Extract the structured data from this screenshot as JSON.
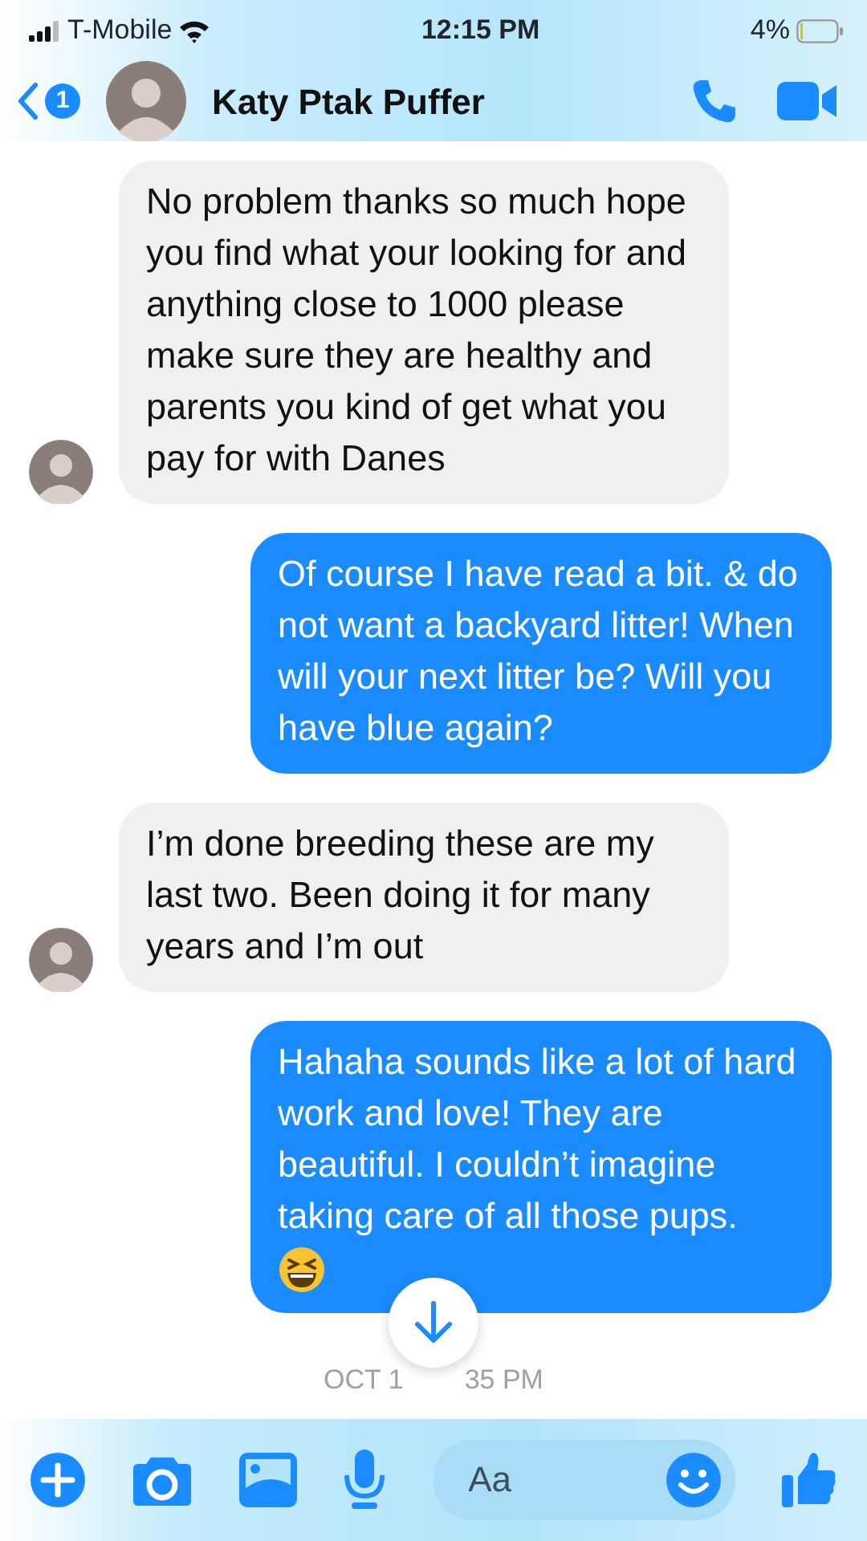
{
  "status_bar": {
    "carrier": "T-Mobile",
    "time": "12:15 PM",
    "battery": "4%"
  },
  "header": {
    "back_badge": "1",
    "contact_name": "Katy Ptak Puffer"
  },
  "messages": [
    {
      "kind": "incoming",
      "text": "No problem thanks so much hope you find what your looking for and anything close to 1000 please make sure they are healthy and parents you kind of get what you pay for with Danes",
      "avatar": true,
      "emoji": false
    },
    {
      "kind": "outgoing",
      "text": "Of course I have read a bit. & do not want a backyard litter! When will your next litter be? Will you have blue again?",
      "avatar": false,
      "emoji": false
    },
    {
      "kind": "incoming",
      "text": "I’m done breeding these are my last two. Been doing it for many years and I’m out",
      "avatar": true,
      "emoji": false
    },
    {
      "kind": "outgoing",
      "text": "Hahaha sounds like a lot of hard work and love! They are beautiful. I couldn’t imagine taking care of all those pups.",
      "avatar": false,
      "emoji": true
    }
  ],
  "timestamp": [
    "OCT 1",
    "35 PM"
  ],
  "composer": {
    "placeholder": "Aa"
  }
}
